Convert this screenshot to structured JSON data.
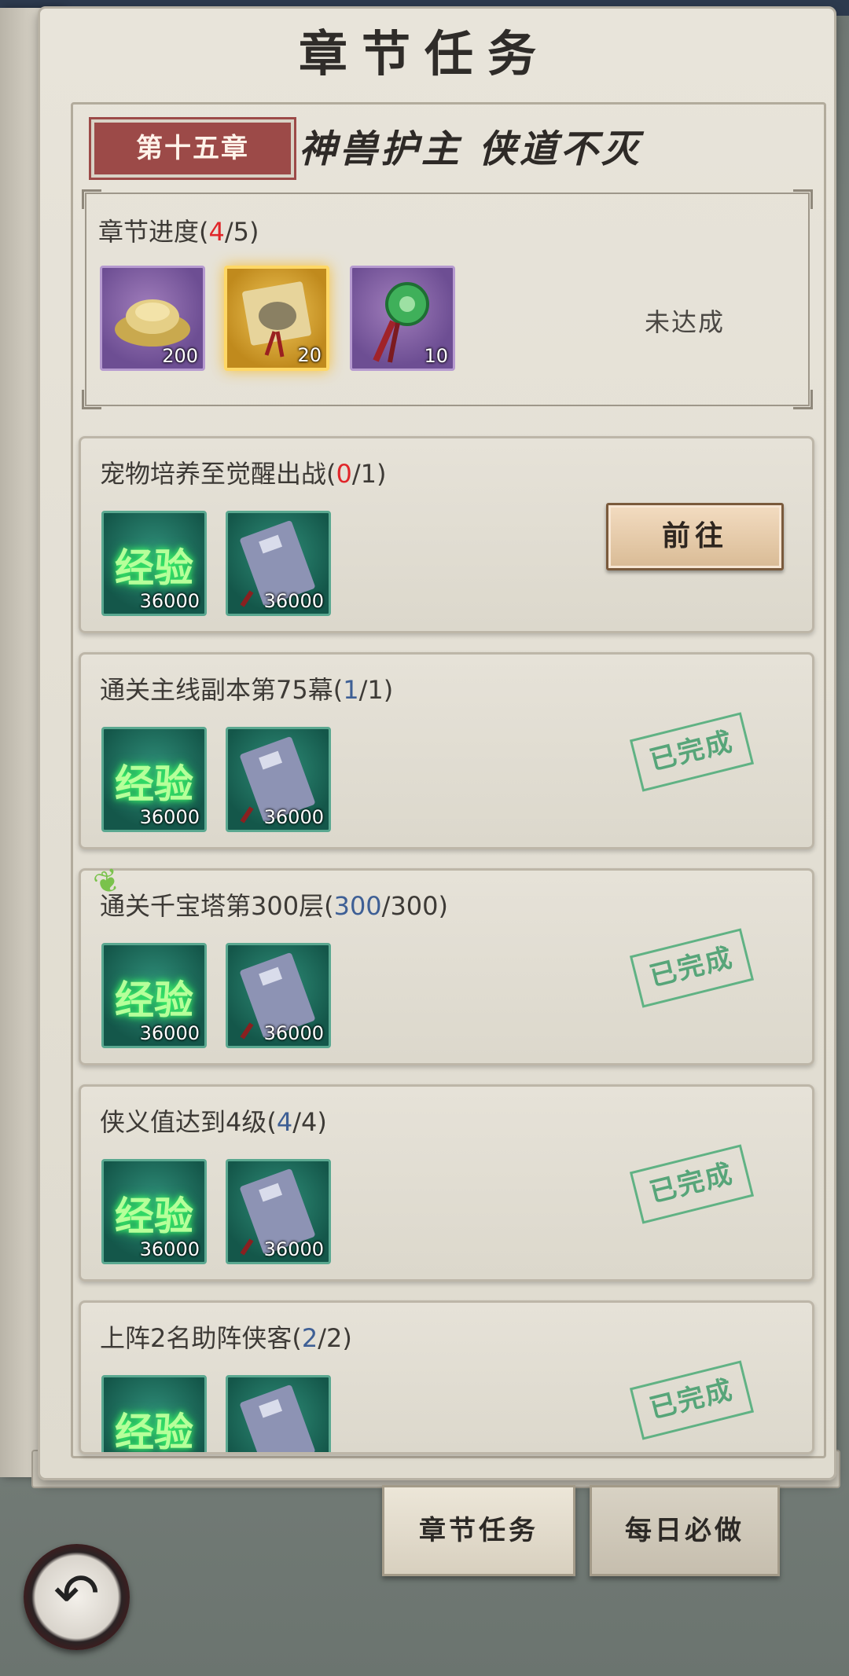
{
  "title": "章节任务",
  "chapter": {
    "number": "第十五章",
    "name": "神兽护主 侠道不灭"
  },
  "progress": {
    "label": "章节进度(",
    "current": "4",
    "sep_total": "/5)",
    "status": "未达成",
    "rewards": [
      {
        "icon": "silver-ingot-icon",
        "qty": "200"
      },
      {
        "icon": "scroll-pouch-icon",
        "qty": "20"
      },
      {
        "icon": "jade-pendant-icon",
        "qty": "10"
      }
    ]
  },
  "tasks": [
    {
      "title": "宠物培养至觉醒出战(",
      "done": "0",
      "total": "/1)",
      "action": "前往",
      "rewards": [
        {
          "label": "经验",
          "qty": "36000"
        },
        {
          "icon": "book-icon",
          "qty": "36000"
        }
      ]
    },
    {
      "title": "通关主线副本第75幕(",
      "done": "1",
      "total": "/1)",
      "status": "已完成",
      "rewards": [
        {
          "label": "经验",
          "qty": "36000"
        },
        {
          "icon": "book-icon",
          "qty": "36000"
        }
      ]
    },
    {
      "title": "通关千宝塔第300层(",
      "done": "300",
      "total": "/300)",
      "status": "已完成",
      "rewards": [
        {
          "label": "经验",
          "qty": "36000"
        },
        {
          "icon": "book-icon",
          "qty": "36000"
        }
      ]
    },
    {
      "title": "侠义值达到4级(",
      "done": "4",
      "total": "/4)",
      "status": "已完成",
      "rewards": [
        {
          "label": "经验",
          "qty": "36000"
        },
        {
          "icon": "book-icon",
          "qty": "36000"
        }
      ]
    },
    {
      "title": "上阵2名助阵侠客(",
      "done": "2",
      "total": "/2)",
      "status": "已完成",
      "rewards": [
        {
          "label": "经验"
        },
        {
          "icon": "book-icon"
        }
      ]
    }
  ],
  "tabs": {
    "chapter_tasks": "章节任务",
    "daily_tasks": "每日必做"
  },
  "colors": {
    "accent_red": "#e0262a",
    "progress_blue": "#3e5f95",
    "stamp_green": "#4aab77",
    "chapter_tag": "#9c4a48"
  }
}
